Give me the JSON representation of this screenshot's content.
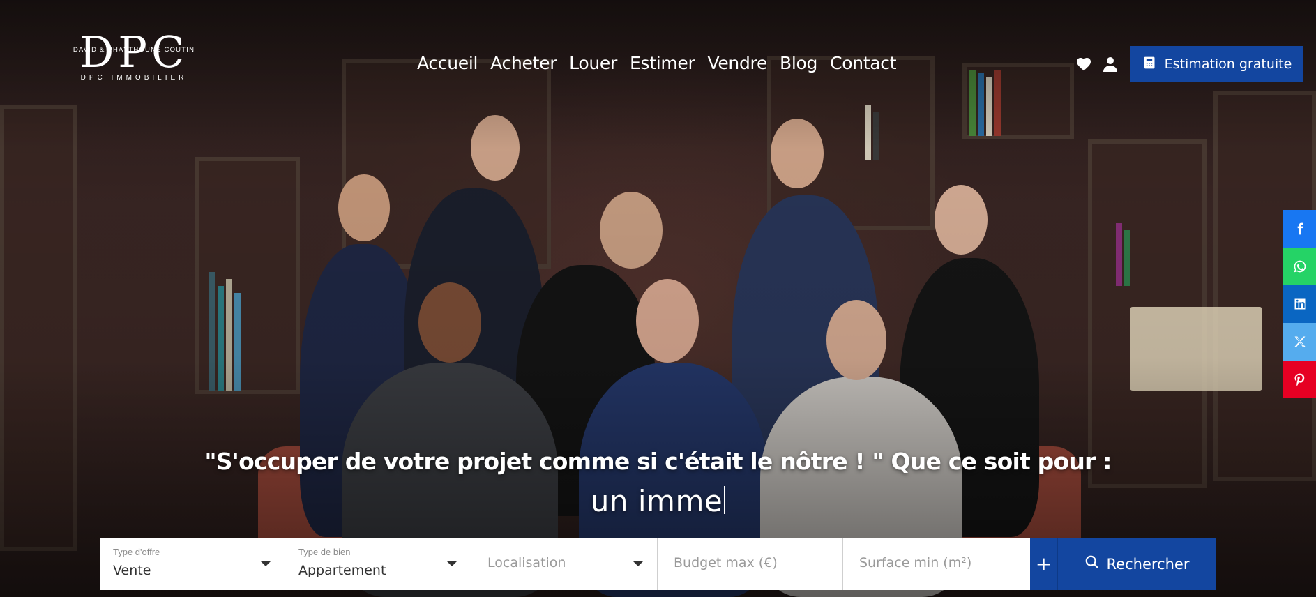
{
  "logo": {
    "top_text": "DAVID & PHAYTHOUNE COUTIN",
    "mark": "DPC",
    "bottom_text": "DPC IMMOBILIER"
  },
  "nav": {
    "items": [
      "Accueil",
      "Acheter",
      "Louer",
      "Estimer",
      "Vendre",
      "Blog",
      "Contact"
    ]
  },
  "header_icons": [
    "heart-icon",
    "user-icon"
  ],
  "estimate_button": {
    "label": "Estimation gratuite",
    "icon": "calculator-icon"
  },
  "hero": {
    "tagline": "\"S'occuper de votre projet comme si c'était le nôtre ! \" Que ce soit pour :",
    "typed_text": "un imme"
  },
  "search": {
    "offer_type": {
      "label": "Type d'offre",
      "value": "Vente"
    },
    "property_type": {
      "label": "Type de bien",
      "value": "Appartement"
    },
    "location": {
      "placeholder": "Localisation"
    },
    "budget": {
      "placeholder": "Budget max (€)"
    },
    "surface": {
      "placeholder": "Surface min (m²)"
    },
    "more_label": "+",
    "submit_label": "Rechercher"
  },
  "social": [
    {
      "name": "facebook",
      "color": "#1877f2"
    },
    {
      "name": "whatsapp",
      "color": "#25d366"
    },
    {
      "name": "linkedin",
      "color": "#0a66c2"
    },
    {
      "name": "x",
      "color": "#55acee"
    },
    {
      "name": "pinterest",
      "color": "#e60023"
    }
  ],
  "colors": {
    "accent": "#1346a0"
  }
}
